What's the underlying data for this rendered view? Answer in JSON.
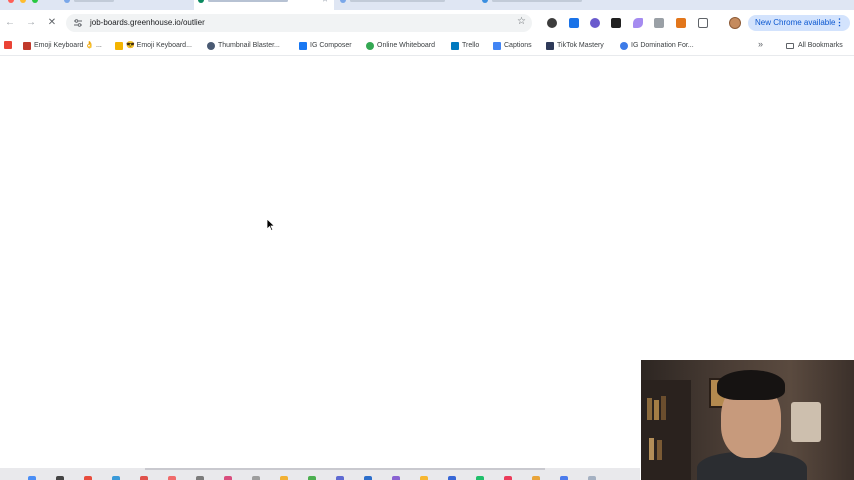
{
  "browser": {
    "url": "job-boards.greenhouse.io/outlier",
    "update_label": "New Chrome available",
    "menu_glyph": "⋮",
    "star_glyph": "☆"
  },
  "bookmarks": [
    {
      "label": "Emoji Keyboard 👌 ...",
      "icon": "emoji-keyboard-icon",
      "color": "#c0392b"
    },
    {
      "label": "😎 Emoji Keyboard...",
      "icon": "sunglasses-icon",
      "color": "#f4b400"
    },
    {
      "label": "Thumbnail Blaster...",
      "icon": "thumbnail-blaster-icon",
      "color": "#4a5a73"
    },
    {
      "label": "IG Composer",
      "icon": "meta-icon",
      "color": "#1877f2"
    },
    {
      "label": "Online Whiteboard",
      "icon": "whiteboard-icon",
      "color": "#34a853"
    },
    {
      "label": "Trello",
      "icon": "trello-icon",
      "color": "#0079bf"
    },
    {
      "label": "Captions",
      "icon": "captions-icon",
      "color": "#4285f4"
    },
    {
      "label": "TikTok Mastery",
      "icon": "kajabi-icon",
      "color": "#2e3a59"
    },
    {
      "label": "IG Domination For...",
      "icon": "s-icon",
      "color": "#3d7be8"
    }
  ],
  "all_bookmarks_label": "All Bookmarks"
}
